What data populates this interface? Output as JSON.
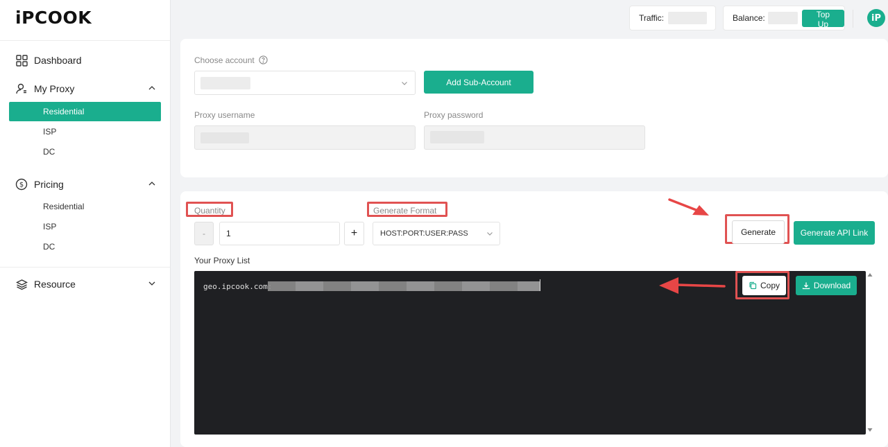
{
  "brand": {
    "logo_text": "iPCOOK"
  },
  "sidebar": {
    "items": [
      {
        "label": "Dashboard",
        "icon": "grid-icon"
      },
      {
        "label": "My Proxy",
        "icon": "user-icon",
        "expanded": true,
        "children": [
          {
            "label": "Residential",
            "active": true
          },
          {
            "label": "ISP"
          },
          {
            "label": "DC"
          }
        ]
      },
      {
        "label": "Pricing",
        "icon": "dollar-circle-icon",
        "expanded": true,
        "children": [
          {
            "label": "Residential"
          },
          {
            "label": "ISP"
          },
          {
            "label": "DC"
          }
        ]
      },
      {
        "label": "Resource",
        "icon": "layers-icon",
        "expanded": false
      }
    ]
  },
  "topbar": {
    "traffic_label": "Traffic:",
    "balance_label": "Balance:",
    "topup_label": "Top Up",
    "avatar_text": "iP"
  },
  "account": {
    "choose_label": "Choose account",
    "add_sub_label": "Add Sub-Account",
    "username_label": "Proxy username",
    "password_label": "Proxy password"
  },
  "generator": {
    "quantity_label": "Quantity",
    "quantity_value": "1",
    "minus": "-",
    "plus": "+",
    "format_label": "Generate Format",
    "format_value": "HOST:PORT:USER:PASS",
    "generate_label": "Generate",
    "api_link_label": "Generate API Link",
    "list_label": "Your Proxy List",
    "proxy_prefix": "geo.ipcook.com:",
    "copy_label": "Copy",
    "download_label": "Download"
  },
  "colors": {
    "accent": "#1aae8e",
    "highlight": "#e05252",
    "console_bg": "#1f2023"
  }
}
